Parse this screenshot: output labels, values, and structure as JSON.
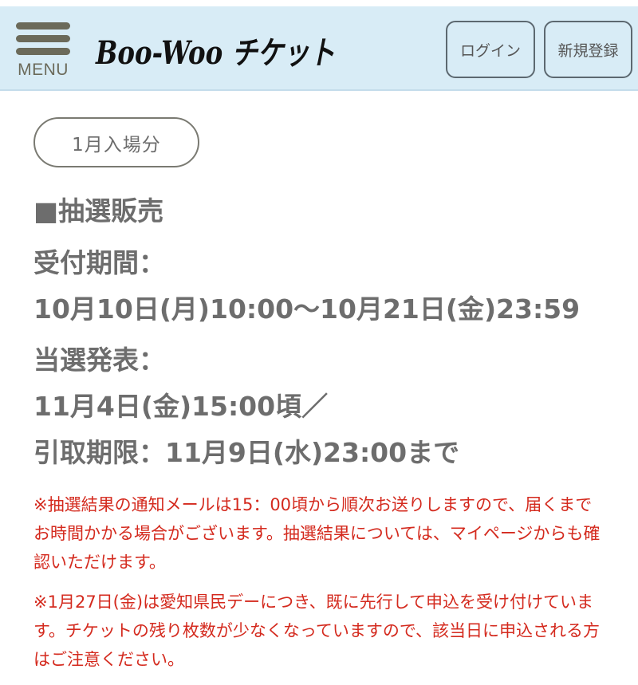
{
  "header": {
    "menu_label": "MENU",
    "logo_text": "Boo-Woo チケット",
    "login_label": "ログイン",
    "register_label": "新規登録",
    "background_color": "#d8ecf6"
  },
  "content": {
    "pill_label": "1月入場分",
    "section_title": "■抽選販売",
    "reception_label": "受付期間：",
    "reception_period": "10月10日(月)10:00〜10月21日(金)23:59",
    "announcement_label": "当選発表：",
    "announcement_date": "11月4日(金)15:00頃／",
    "pickup_deadline": "引取期限：11月9日(水)23:00まで",
    "notes": [
      "※抽選結果の通知メールは15：00頃から順次お送りしますので、届くまでお時間かかる場合がございます。抽選結果については、マイページからも確認いただけます。",
      "※1月27日(金)は愛知県民デーにつき、既に先行して申込を受け付けています。チケットの残り枚数が少なくなっていますので、該当日に申込される方はご注意ください。"
    ],
    "note_color": "#d42a1e"
  }
}
